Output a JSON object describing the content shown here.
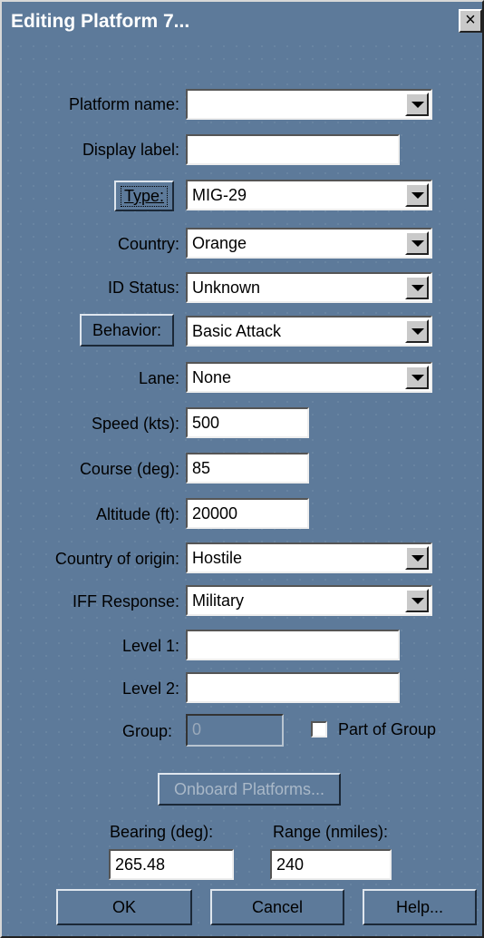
{
  "window": {
    "title": "Editing Platform 7...",
    "close_label": "×"
  },
  "fields": {
    "platform_name": {
      "label": "Platform name:",
      "value": ""
    },
    "display_label": {
      "label": "Display label:",
      "value": ""
    },
    "type": {
      "label": "Type:",
      "value": "MIG-29"
    },
    "country": {
      "label": "Country:",
      "value": "Orange"
    },
    "id_status": {
      "label": "ID Status:",
      "value": "Unknown"
    },
    "behavior": {
      "label": "Behavior:",
      "value": "Basic Attack"
    },
    "lane": {
      "label": "Lane:",
      "value": "None"
    },
    "speed": {
      "label": "Speed (kts):",
      "value": "500"
    },
    "course": {
      "label": "Course (deg):",
      "value": "85"
    },
    "altitude": {
      "label": "Altitude (ft):",
      "value": "20000"
    },
    "country_of_origin": {
      "label": "Country of origin:",
      "value": "Hostile"
    },
    "iff_response": {
      "label": "IFF Response:",
      "value": "Military"
    },
    "level1": {
      "label": "Level 1:",
      "value": ""
    },
    "level2": {
      "label": "Level 2:",
      "value": ""
    },
    "group": {
      "label": "Group:",
      "value": "0"
    },
    "part_of_group": {
      "label": "Part of Group",
      "checked": false
    },
    "bearing": {
      "label": "Bearing (deg):",
      "value": "265.48"
    },
    "range": {
      "label": "Range (nmiles):",
      "value": "240"
    }
  },
  "buttons": {
    "onboard_platforms": "Onboard Platforms...",
    "ok": "OK",
    "cancel": "Cancel",
    "help": "Help..."
  }
}
